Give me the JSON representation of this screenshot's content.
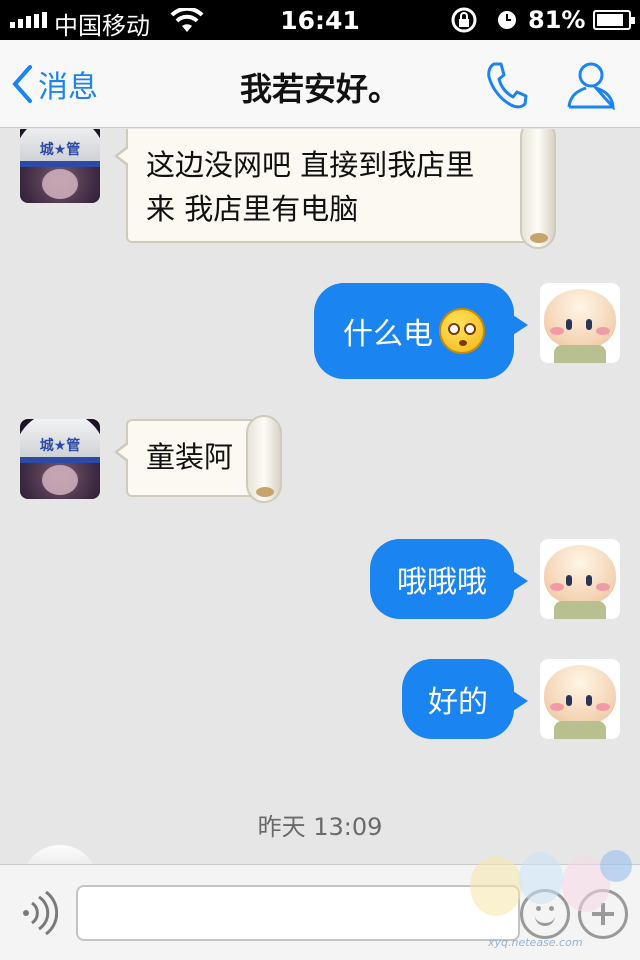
{
  "status_bar": {
    "carrier": "中国移动",
    "time": "16:41",
    "battery_percent": "81%",
    "battery_level": 0.81,
    "icons": [
      "signal-icon",
      "wifi-icon",
      "rotation-lock-icon",
      "alarm-icon",
      "battery-charging-icon"
    ]
  },
  "nav": {
    "back_label": "消息",
    "title": "我若安好。",
    "icons": [
      "chevron-left-icon",
      "phone-icon",
      "contact-icon"
    ]
  },
  "messages": [
    {
      "side": "left",
      "text_line1": "这边没网吧 直接到我店里",
      "text_line2": "来 我店里有电脑"
    },
    {
      "side": "right",
      "text": "什么电",
      "emoji": "angry-face-emoji"
    },
    {
      "side": "left",
      "text": "童装阿"
    },
    {
      "side": "right",
      "text": "哦哦哦"
    },
    {
      "side": "right",
      "text": "好的"
    }
  ],
  "left_avatar": {
    "helmet_text": "城★管"
  },
  "timestamp": "昨天 13:09",
  "input_bar": {
    "placeholder": "",
    "icons": [
      "voice-icon",
      "emoji-icon",
      "plus-icon"
    ]
  },
  "watermark": {
    "url": "xyq.netease.com"
  },
  "colors": {
    "accent": "#1a84f4",
    "bubble_right": "#1a84f0",
    "chat_background": "#e6e6e6"
  }
}
